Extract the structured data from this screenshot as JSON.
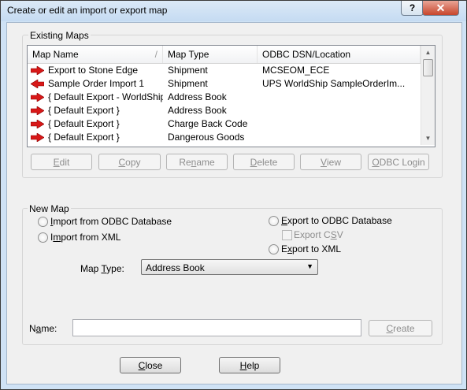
{
  "window": {
    "title": "Create or edit an import or export map"
  },
  "titlebar": {
    "help_icon": "?",
    "close_icon": "✕"
  },
  "existing_maps": {
    "legend": "Existing Maps",
    "columns": [
      "Map Name",
      "Map Type",
      "ODBC DSN/Location"
    ],
    "rows": [
      {
        "name": "Export to Stone Edge",
        "type": "Shipment",
        "dsn": "MCSEOM_ECE",
        "icon": "export-arrow-icon"
      },
      {
        "name": "Sample Order Import 1",
        "type": "Shipment",
        "dsn": "UPS WorldShip SampleOrderIm...",
        "icon": "import-arrow-icon"
      },
      {
        "name": "{ Default Export - WorldShip }",
        "type": "Address Book",
        "dsn": "",
        "icon": "export-arrow-icon"
      },
      {
        "name": "{ Default Export }",
        "type": "Address Book",
        "dsn": "",
        "icon": "export-arrow-icon"
      },
      {
        "name": "{ Default Export }",
        "type": "Charge Back Code",
        "dsn": "",
        "icon": "export-arrow-icon"
      },
      {
        "name": "{ Default Export }",
        "type": "Dangerous Goods",
        "dsn": "",
        "icon": "export-arrow-icon"
      }
    ],
    "buttons": {
      "edit": {
        "pre": "",
        "ul": "E",
        "post": "dit"
      },
      "copy": {
        "pre": "",
        "ul": "C",
        "post": "opy"
      },
      "rename": {
        "pre": "Re",
        "ul": "n",
        "post": "ame"
      },
      "delete": {
        "pre": "",
        "ul": "D",
        "post": "elete"
      },
      "view": {
        "pre": "",
        "ul": "V",
        "post": "iew"
      },
      "odbc_login": {
        "pre": "",
        "ul": "O",
        "post": "DBC Login"
      }
    }
  },
  "new_map": {
    "legend": "New Map",
    "import_odbc": {
      "pre": "",
      "ul": "I",
      "post": "mport from ODBC Database"
    },
    "import_xml": {
      "pre": "I",
      "ul": "m",
      "post": "port from XML"
    },
    "export_odbc": {
      "pre": "",
      "ul": "E",
      "post": "xport to ODBC Database"
    },
    "export_csv": {
      "pre": "Export C",
      "ul": "S",
      "post": "V"
    },
    "export_xml": {
      "pre": "E",
      "ul": "x",
      "post": "port to XML"
    },
    "map_type_label": {
      "pre": "Map ",
      "ul": "T",
      "post": "ype:"
    },
    "map_type_value": "Address Book",
    "name_label": {
      "pre": "N",
      "ul": "a",
      "post": "me:"
    },
    "name_value": "",
    "create": {
      "pre": "",
      "ul": "C",
      "post": "reate"
    }
  },
  "footer": {
    "close": {
      "pre": "",
      "ul": "C",
      "post": "lose"
    },
    "help": {
      "pre": "",
      "ul": "H",
      "post": "elp"
    }
  },
  "colors": {
    "accent_red": "#d81818",
    "title_bg": "#cfe2f5",
    "dialog_bg": "#f0f0f0"
  }
}
